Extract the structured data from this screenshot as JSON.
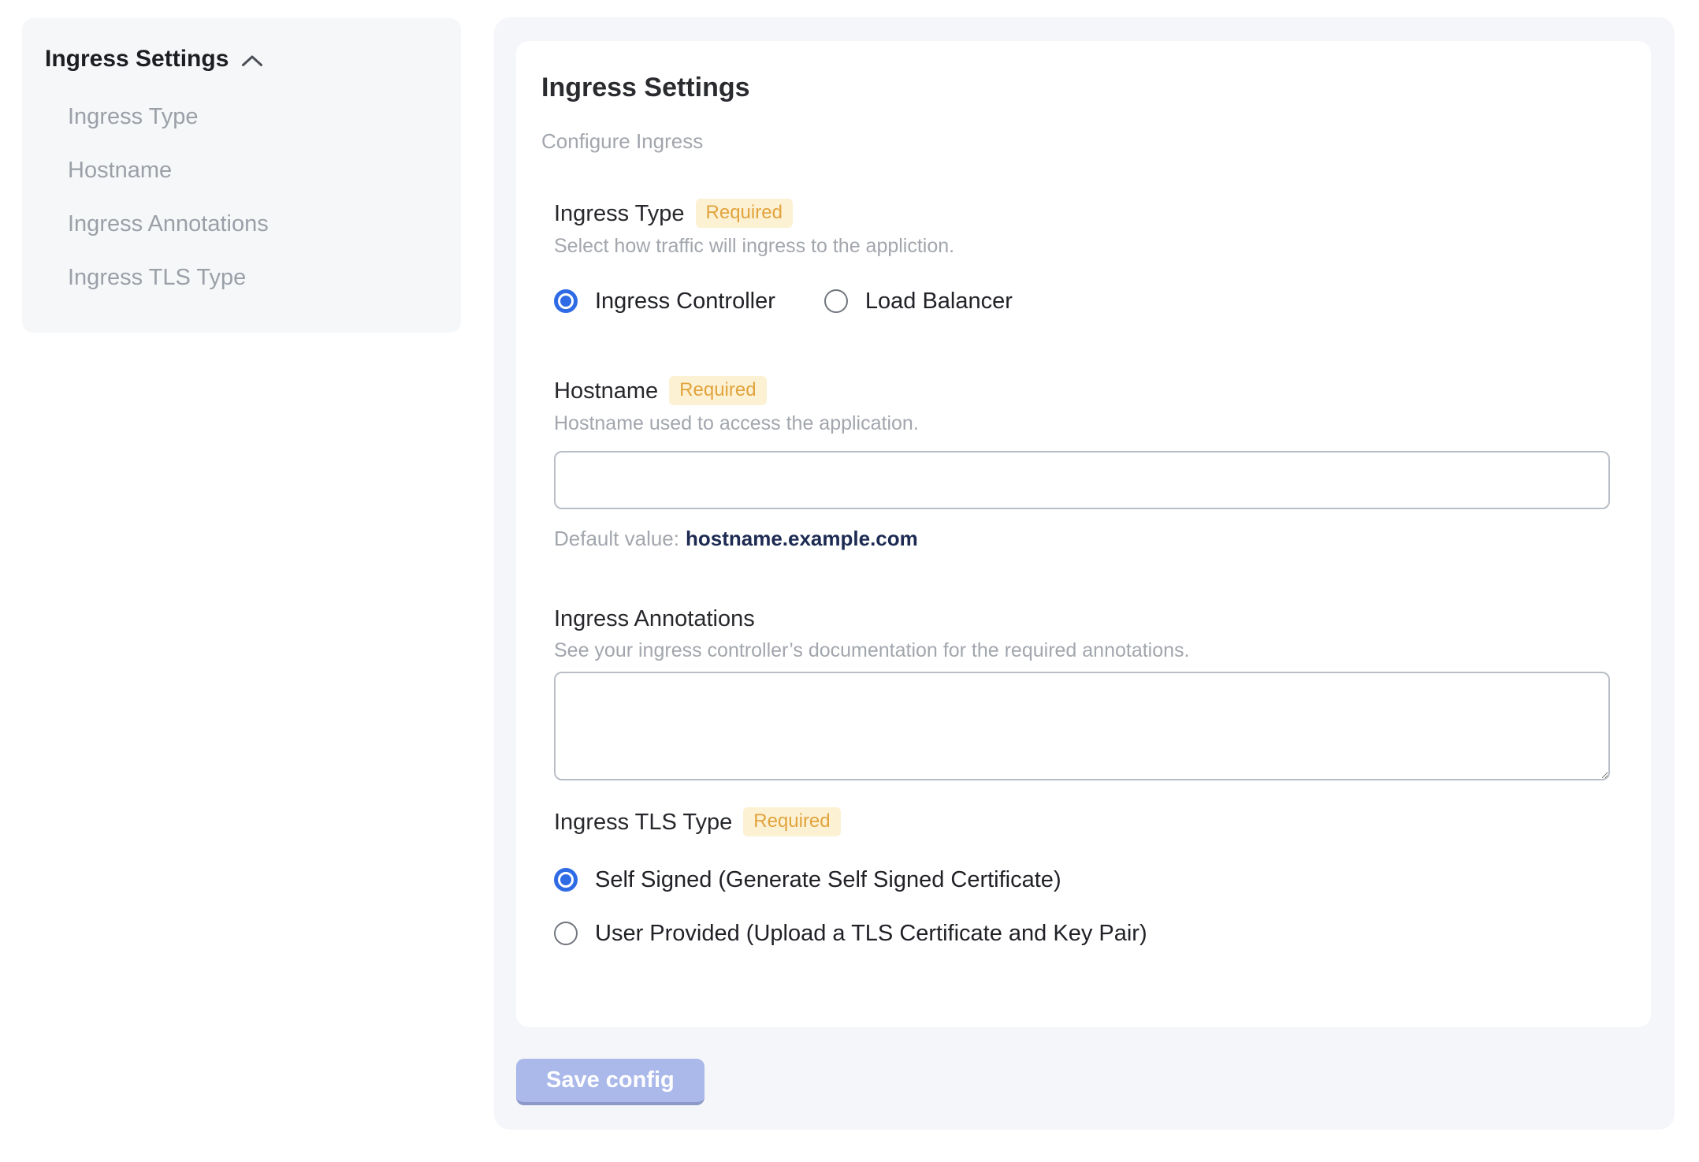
{
  "colors": {
    "accent_blue": "#2e6be4",
    "badge_bg": "#fcf1d2",
    "badge_text": "#e2a33d",
    "panel_bg": "#f5f6f9",
    "sidebar_bg": "#f6f7f9",
    "default_value_text": "#1d2a52",
    "save_button_bg": "#aab8ea",
    "save_button_edge": "#8c99c8"
  },
  "sidebar": {
    "title": "Ingress Settings",
    "collapse_icon": "chevron-up-icon",
    "items": [
      {
        "label": "Ingress Type"
      },
      {
        "label": "Hostname"
      },
      {
        "label": "Ingress Annotations"
      },
      {
        "label": "Ingress TLS Type"
      }
    ]
  },
  "main": {
    "title": "Ingress Settings",
    "subtitle": "Configure Ingress",
    "required_label": "Required",
    "sections": {
      "ingress_type": {
        "label": "Ingress Type",
        "required": true,
        "help": "Select how traffic will ingress to the appliction.",
        "options": [
          {
            "label": "Ingress Controller",
            "selected": true
          },
          {
            "label": "Load Balancer",
            "selected": false
          }
        ]
      },
      "hostname": {
        "label": "Hostname",
        "required": true,
        "help": "Hostname used to access the application.",
        "value": "",
        "default_prefix": "Default value:",
        "default_value": "hostname.example.com"
      },
      "annotations": {
        "label": "Ingress Annotations",
        "required": false,
        "help": "See your ingress controller’s documentation for the required annotations.",
        "value": ""
      },
      "tls": {
        "label": "Ingress TLS Type",
        "required": true,
        "options": [
          {
            "label": "Self Signed (Generate Self Signed Certificate)",
            "selected": true
          },
          {
            "label": "User Provided (Upload a TLS Certificate and Key Pair)",
            "selected": false
          }
        ]
      }
    },
    "save_button_label": "Save config"
  }
}
